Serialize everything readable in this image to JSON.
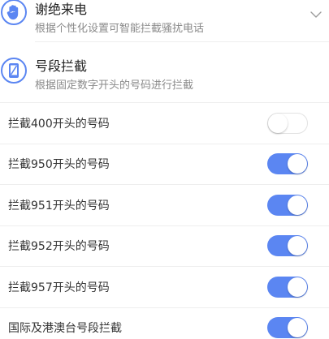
{
  "features": {
    "decline_call": {
      "title": "谢绝来电",
      "subtitle": "根据个性化设置可智能拦截骚扰电话",
      "icon": "hand-stop-icon",
      "expand_icon": "chevron-down-icon"
    },
    "prefix_block": {
      "title": "号段拦截",
      "subtitle": "根据固定数字开头的号码进行拦截",
      "icon": "phone-slash-icon"
    }
  },
  "rules": [
    {
      "label": "拦截400开头的号码",
      "enabled": false
    },
    {
      "label": "拦截950开头的号码",
      "enabled": true
    },
    {
      "label": "拦截951开头的号码",
      "enabled": true
    },
    {
      "label": "拦截952开头的号码",
      "enabled": true
    },
    {
      "label": "拦截957开头的号码",
      "enabled": true
    },
    {
      "label": "国际及港澳台号段拦截",
      "enabled": true
    }
  ],
  "colors": {
    "accent": "#5b86f2",
    "toggle_off_border": "#e2e2e2",
    "divider": "#eeeeee",
    "title_text": "#222222",
    "subtitle_text": "#8a8a8a"
  }
}
